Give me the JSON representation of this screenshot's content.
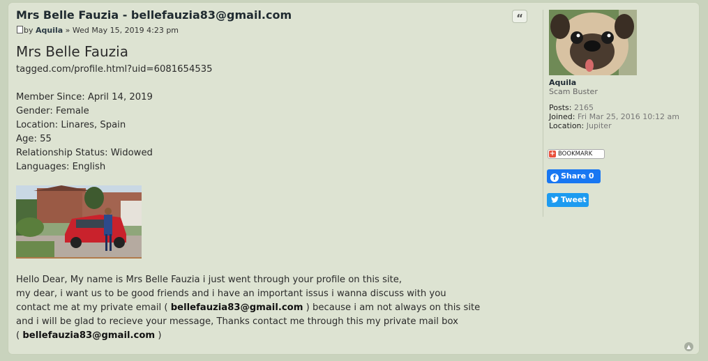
{
  "post": {
    "title": "Mrs Belle Fauzia - bellefauzia83@gmail.com",
    "meta_by": "by",
    "author": "Aquila",
    "meta_sep": " » ",
    "date": "Wed May 15, 2019 4:23 pm",
    "quote_label": "“"
  },
  "content": {
    "heading": "Mrs Belle Fauzia",
    "profile_url": "tagged.com/profile.html?uid=6081654535",
    "details": [
      "Member Since: April 14, 2019",
      "Gender: Female",
      "Location: Linares, Spain",
      "Age: 55",
      "Relationship Status: Widowed",
      "Languages: English"
    ],
    "message": {
      "line1": "Hello Dear, My name is Mrs Belle Fauzia i just went through your profile on this site,",
      "line2": "my dear, i want us to be good friends and i have an important issus i wanna discuss with you",
      "line3_pre": "contact me at my private email ( ",
      "email": "bellefauzia83@gmail.com",
      "line3_post": " ) because i am not always on this site",
      "line4": "and i will be glad to recieve your message, Thanks contact me through this my private mail box",
      "line5_pre": "( ",
      "line5_post": " )"
    }
  },
  "profile": {
    "name": "Aquila",
    "rank": "Scam Buster",
    "posts_label": "Posts:",
    "posts_value": "2165",
    "joined_label": "Joined:",
    "joined_value": "Fri Mar 25, 2016 10:12 am",
    "location_label": "Location:",
    "location_value": "Jupiter"
  },
  "share": {
    "bookmark_label": "BOOKMARK",
    "facebook_label": "Share 0",
    "tweet_label": "Tweet"
  },
  "icons": {
    "document": "doc-icon",
    "quote": "quote-icon",
    "bookmark_plus": "plus-icon",
    "facebook": "facebook-icon",
    "twitter": "twitter-icon",
    "back_to_top": "chevron-up-icon"
  },
  "colors": {
    "page_bg": "#c9d3bd",
    "post_bg": "#dde3d2",
    "facebook": "#1877f2",
    "twitter": "#1d9bf0"
  }
}
